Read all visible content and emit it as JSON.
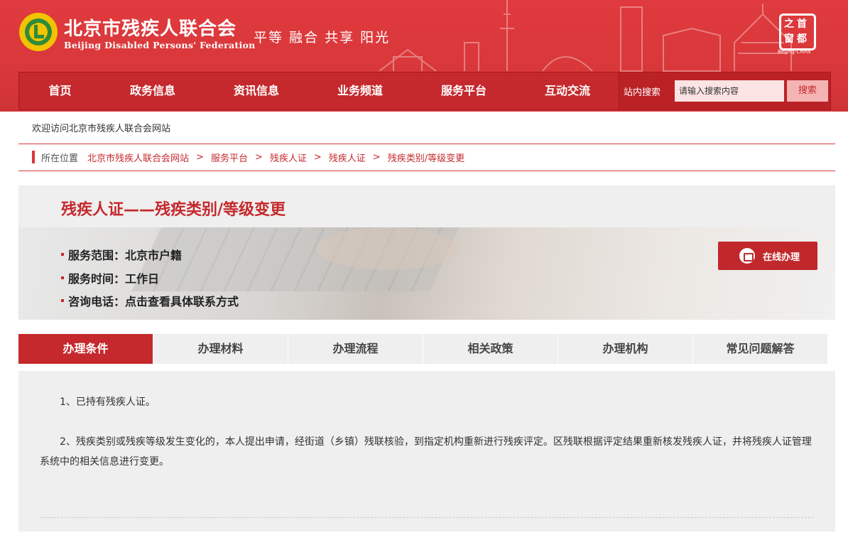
{
  "header": {
    "brand_cn": "北京市残疾人联合会",
    "brand_en": "Beijing Disabled Persons' Federation",
    "slogan": "平等 融合 共享 阳光",
    "seal": {
      "chars": [
        "首",
        "都",
        "之",
        "窗"
      ],
      "sub": "Beijing-China"
    },
    "logo_icon": "federation-logo-icon",
    "accent_color": "#d9383a"
  },
  "nav": {
    "items": [
      "首页",
      "政务信息",
      "资讯信息",
      "业务频道",
      "服务平台",
      "互动交流"
    ],
    "search_label": "站内搜索",
    "search_placeholder": "请输入搜索内容",
    "search_button": "搜索"
  },
  "welcome": "欢迎访问北京市残疾人联合会网站",
  "breadcrumb": {
    "label": "所在位置",
    "items": [
      "北京市残疾人联合会网站",
      "服务平台",
      "残疾人证",
      "残疾人证",
      "残疾类别/等级变更"
    ],
    "separator": ">"
  },
  "service": {
    "title": "残疾人证——残疾类别/等级变更",
    "info": [
      {
        "label": "服务范围：",
        "value": "北京市户籍"
      },
      {
        "label": "服务时间：",
        "value": "工作日"
      },
      {
        "label": "咨询电话：",
        "value": "点击查看具体联系方式"
      }
    ],
    "online_button": "在线办理"
  },
  "tabs": [
    "办理条件",
    "办理材料",
    "办理流程",
    "相关政策",
    "办理机构",
    "常见问题解答"
  ],
  "active_tab": "办理条件",
  "content": {
    "paragraphs": [
      "1、已持有残疾人证。",
      "2、残疾类别或残疾等级发生变化的，本人提出申请，经街道（乡镇）残联核验，到指定机构重新进行残疾评定。区残联根据评定结果重新核发残疾人证，并将残疾人证管理系统中的相关信息进行变更。"
    ]
  }
}
